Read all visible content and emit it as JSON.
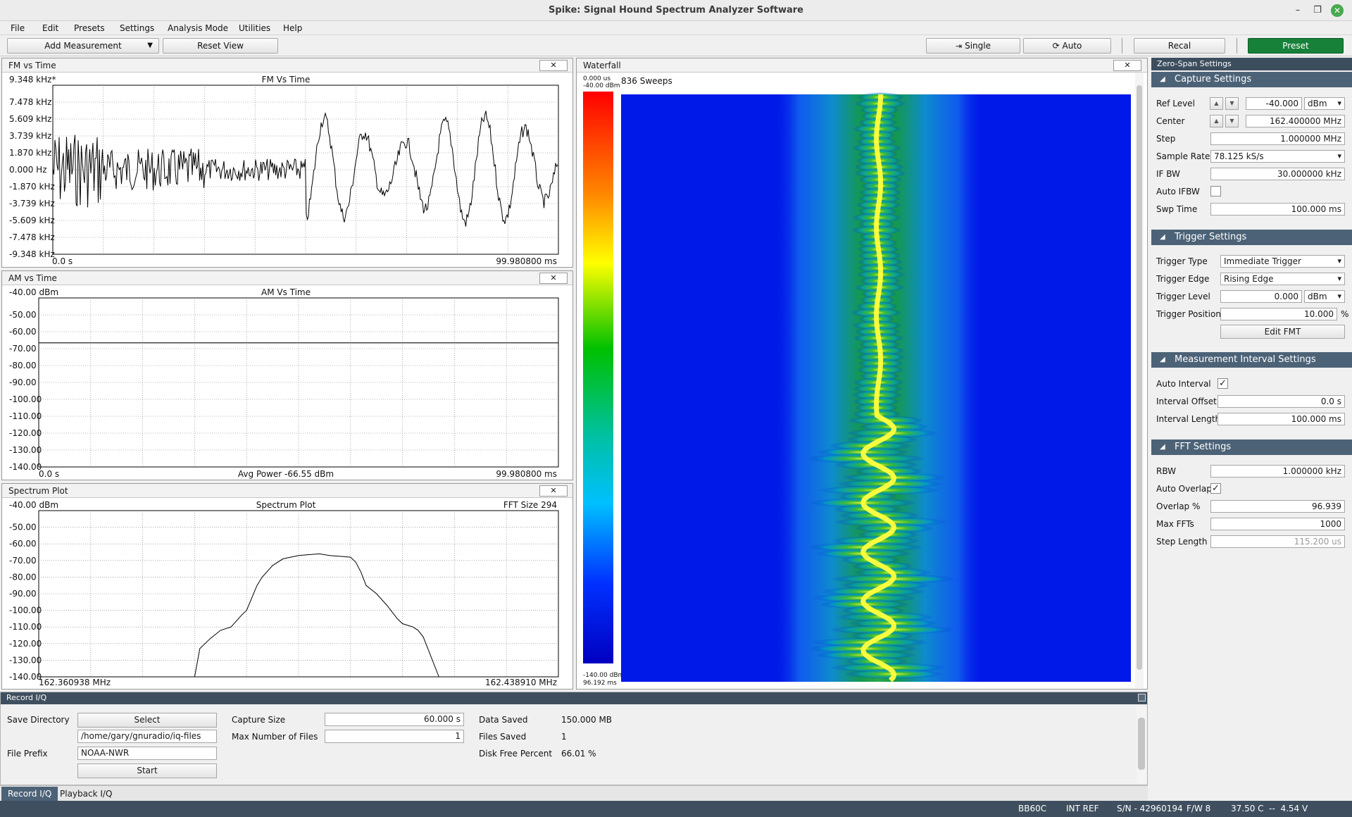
{
  "window": {
    "title": "Spike: Signal Hound Spectrum Analyzer Software"
  },
  "menu": [
    "File",
    "Edit",
    "Presets",
    "Settings",
    "Analysis Mode",
    "Utilities",
    "Help"
  ],
  "toolbar": {
    "add_measurement": "Add Measurement",
    "reset_view": "Reset View",
    "single": "Single",
    "auto": "Auto",
    "recal": "Recal",
    "preset": "Preset",
    "preset_color": "#17813a"
  },
  "panels": {
    "fm": {
      "title": "FM vs Time",
      "plot_title": "FM Vs Time",
      "ref_label": "9.348 kHz*",
      "y_labels": [
        "7.478 kHz",
        "5.609 kHz",
        "3.739 kHz",
        "1.870 kHz",
        "0.000 Hz",
        "-1.870 kHz",
        "-3.739 kHz",
        "-5.609 kHz",
        "-7.478 kHz",
        "-9.348 kHz"
      ],
      "x_start": "0.0 s",
      "x_end": "99.980800 ms"
    },
    "am": {
      "title": "AM vs Time",
      "plot_title": "AM Vs Time",
      "ref_label": "-40.00 dBm",
      "y_labels": [
        "-50.00",
        "-60.00",
        "-70.00",
        "-80.00",
        "-90.00",
        "-100.00",
        "-110.00",
        "-120.00",
        "-130.00",
        "-140.00"
      ],
      "x_start": "0.0 s",
      "x_mid": "Avg Power -66.55 dBm",
      "x_end": "99.980800 ms",
      "level_dbm": -66.55
    },
    "spectrum": {
      "title": "Spectrum Plot",
      "plot_title": "Spectrum Plot",
      "ref_label": "-40.00 dBm",
      "fft_size": "FFT Size 294",
      "y_labels": [
        "-50.00",
        "-60.00",
        "-70.00",
        "-80.00",
        "-90.00",
        "-100.00",
        "-110.00",
        "-120.00",
        "-130.00",
        "-140.00"
      ],
      "x_start": "162.360938 MHz",
      "x_end": "162.438910 MHz"
    },
    "waterfall": {
      "title": "Waterfall",
      "sweeps": "836 Sweeps",
      "top_time": "0.000 us",
      "top_level": "-40.00 dBm",
      "bottom_level": "-140.00 dBm",
      "bottom_time": "96.192 ms"
    },
    "close_glyph": "✕"
  },
  "settings": {
    "header": "Zero-Span Settings",
    "capture": {
      "title": "Capture Settings",
      "ref_level_label": "Ref Level",
      "ref_level": "-40.000",
      "ref_unit": "dBm",
      "center_label": "Center",
      "center": "162.400000 MHz",
      "step_label": "Step",
      "step": "1.000000 MHz",
      "sample_rate_label": "Sample Rate",
      "sample_rate": "78.125 kS/s",
      "ifbw_label": "IF BW",
      "ifbw": "30.000000 kHz",
      "auto_ifbw_label": "Auto IFBW",
      "auto_ifbw": "",
      "swp_time_label": "Swp Time",
      "swp_time": "100.000 ms"
    },
    "trigger": {
      "title": "Trigger Settings",
      "type_label": "Trigger Type",
      "type": "Immediate Trigger",
      "edge_label": "Trigger Edge",
      "edge": "Rising Edge",
      "level_label": "Trigger Level",
      "level": "0.000",
      "level_unit": "dBm",
      "position_label": "Trigger Position",
      "position": "10.000",
      "position_unit": "%",
      "edit_fmt": "Edit FMT"
    },
    "interval": {
      "title": "Measurement Interval Settings",
      "auto_label": "Auto Interval",
      "auto_check": "✓",
      "offset_label": "Interval Offset",
      "offset": "0.0 s",
      "length_label": "Interval Length",
      "length": "100.000 ms"
    },
    "fft": {
      "title": "FFT Settings",
      "rbw_label": "RBW",
      "rbw": "1.000000 kHz",
      "auto_overlap_label": "Auto Overlap",
      "auto_overlap_check": "✓",
      "overlap_label": "Overlap %",
      "overlap": "96.939",
      "max_ffts_label": "Max FFTs",
      "max_ffts": "1000",
      "step_length_label": "Step Length",
      "step_length": "115.200 us"
    }
  },
  "record_iq": {
    "title": "Record I/Q",
    "save_directory_label": "Save Directory",
    "select": "Select",
    "directory": "/home/gary/gnuradio/iq-files",
    "file_prefix_label": "File Prefix",
    "file_prefix": "NOAA-NWR",
    "start": "Start",
    "capture_size_label": "Capture Size",
    "capture_size": "60.000 s",
    "max_files_label": "Max Number of Files",
    "max_files": "1",
    "data_saved_label": "Data Saved",
    "data_saved": "150.000 MB",
    "files_saved_label": "Files Saved",
    "files_saved": "1",
    "disk_free_label": "Disk Free Percent",
    "disk_free": "66.01 %"
  },
  "tabs": [
    "Record I/Q",
    "Playback I/Q"
  ],
  "status": {
    "device": "BB60C",
    "ref": "INT REF",
    "serial": "S/N - 42960194",
    "firmware": "F/W 8",
    "temp_voltage": "37.50 C  --  4.54 V"
  },
  "colors": {
    "section_header": "#4c6277",
    "status_bar": "#3f4f5f",
    "waterfall_bg": "#0010e8",
    "signal_core": "#ffff20",
    "signal_green": "#10b030"
  }
}
